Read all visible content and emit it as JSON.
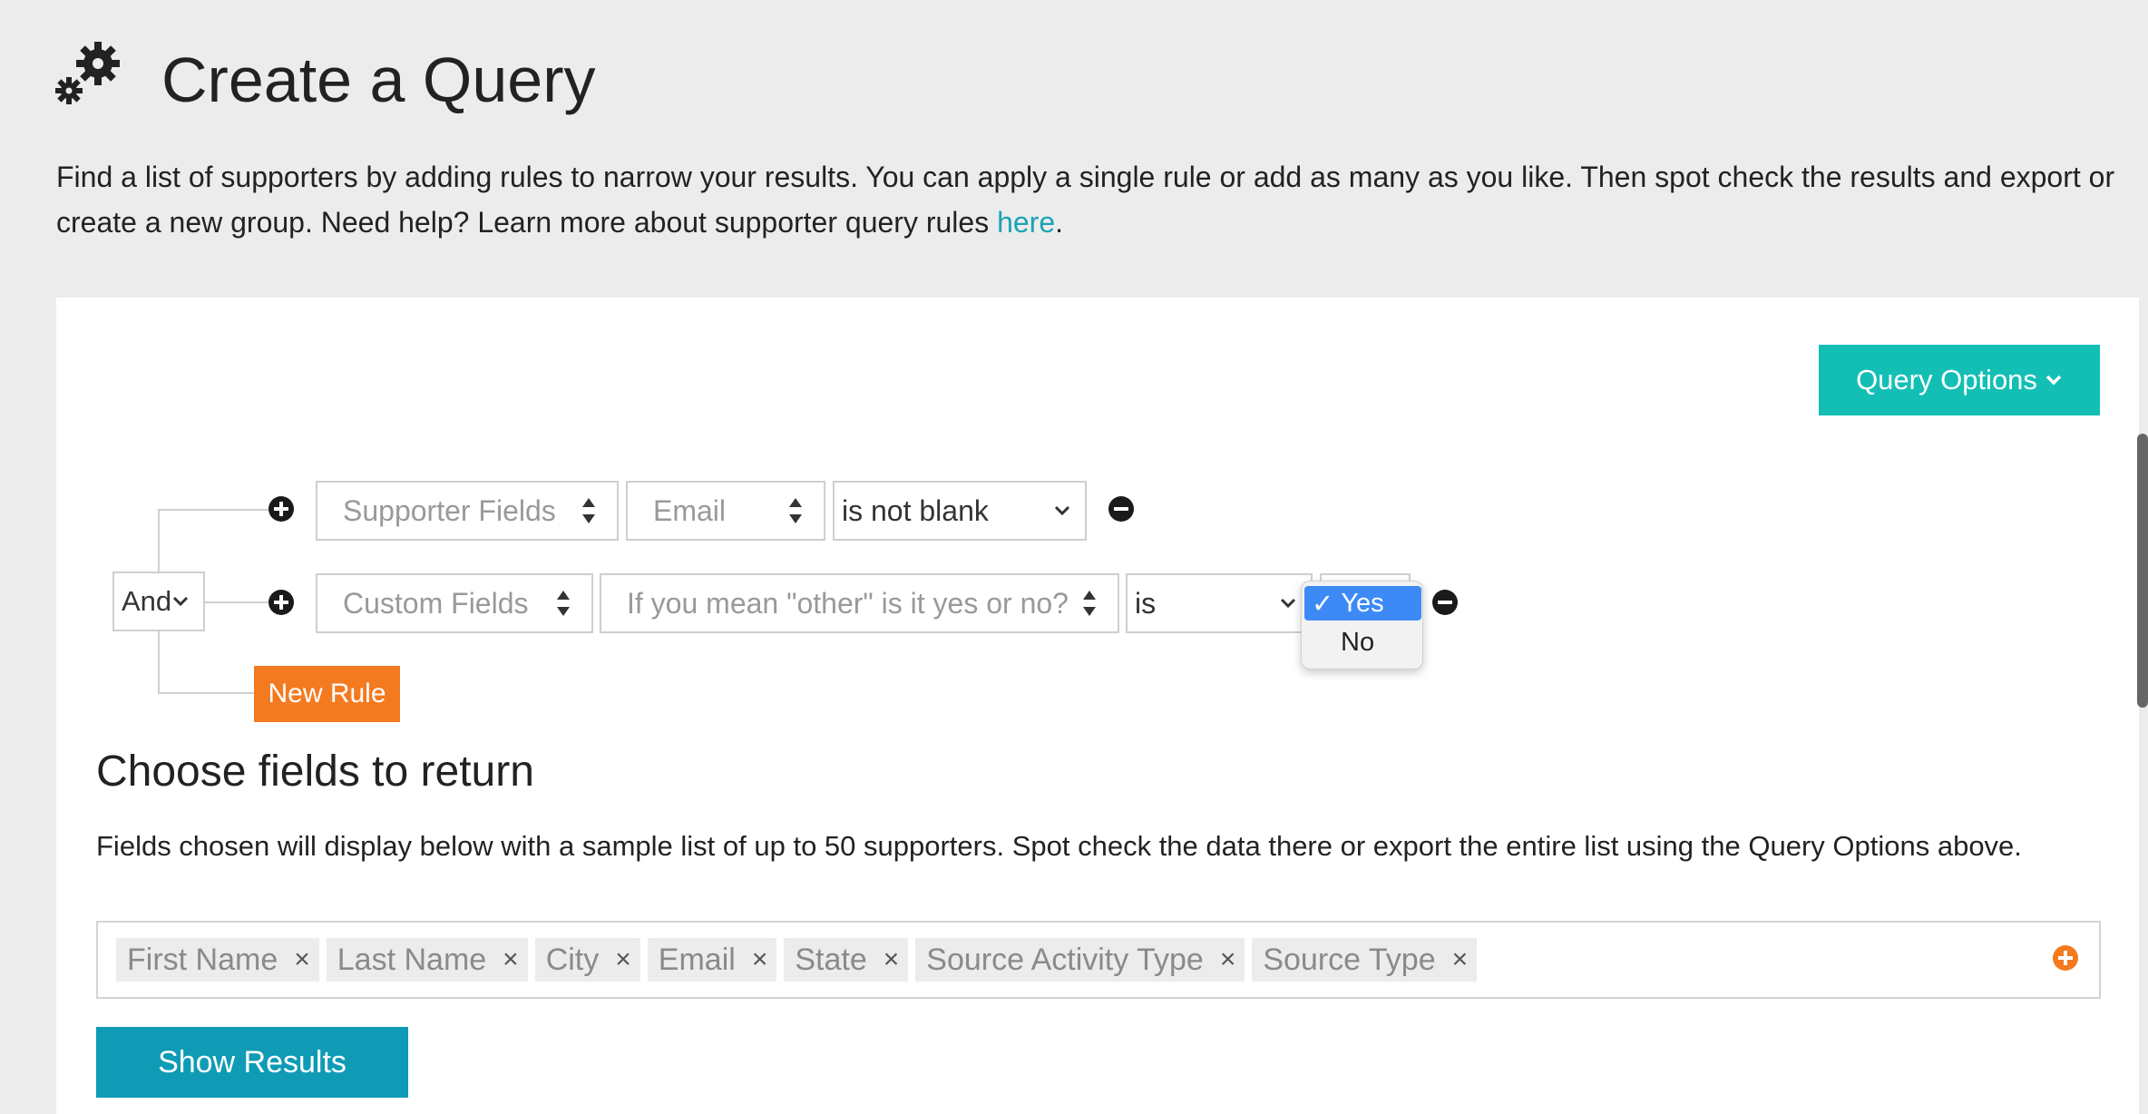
{
  "header": {
    "title": "Create a Query",
    "intro_text": "Find a list of supporters by adding rules to narrow your results. You can apply a single rule or add as many as you like. Then spot check the results and export or create a new group. Need help? Learn more about supporter query rules ",
    "intro_link": "here",
    "intro_end": "."
  },
  "toolbar": {
    "query_options_label": "Query Options"
  },
  "query": {
    "logic_operator": "And",
    "rules": [
      {
        "category": "Supporter Fields",
        "field": "Email",
        "operator": "is not blank"
      },
      {
        "category": "Custom Fields",
        "field": "If you mean \"other\" is it yes or no?",
        "operator": "is",
        "value_options": [
          "Yes",
          "No"
        ],
        "selected_value": "Yes"
      }
    ],
    "new_rule_label": "New Rule"
  },
  "return_fields": {
    "heading": "Choose fields to return",
    "description": "Fields chosen will display below with a sample list of up to 50 supporters. Spot check the data there or export the entire list using the Query Options above.",
    "tags": [
      "First Name",
      "Last Name",
      "City",
      "Email",
      "State",
      "Source Activity Type",
      "Source Type"
    ],
    "remove_glyph": "×"
  },
  "actions": {
    "show_results_label": "Show Results"
  },
  "colors": {
    "teal": "#13bfb5",
    "orange": "#f47a20",
    "link": "#1aa3b8",
    "button": "#0f9bb5"
  }
}
